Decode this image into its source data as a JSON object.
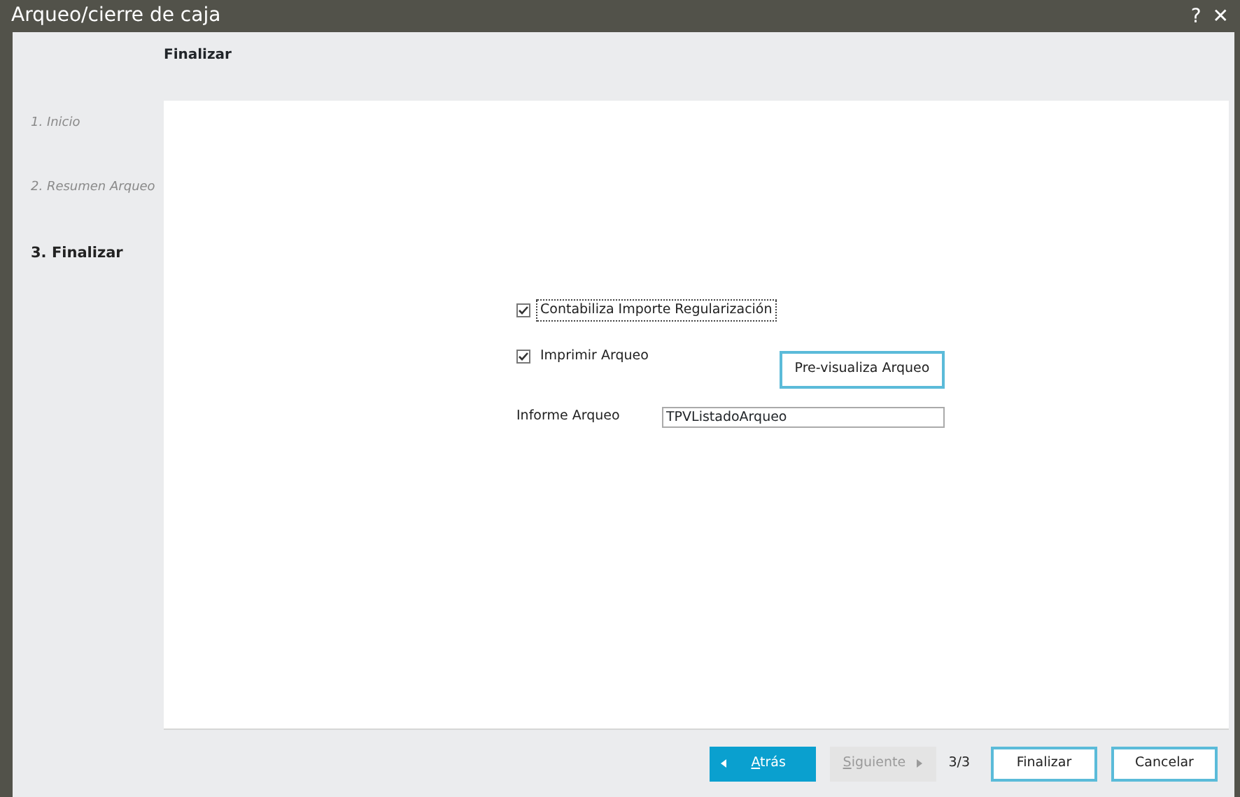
{
  "window": {
    "title": "Arqueo/cierre de caja",
    "help": "?",
    "close": "✕"
  },
  "header": {
    "title": "Finalizar"
  },
  "steps": [
    {
      "label": "1. Inicio",
      "selected": false
    },
    {
      "label": "2. Resumen Arqueo",
      "selected": false
    },
    {
      "label": "3. Finalizar",
      "selected": true
    }
  ],
  "options": [
    {
      "label": "Contabiliza Importe Regularización",
      "checked": true,
      "focused": true
    },
    {
      "label": "Imprimir Arqueo",
      "checked": true,
      "focused": false
    }
  ],
  "preview_button": "Pre-visualiza Arqueo",
  "report": {
    "label": "Informe Arqueo",
    "value": "TPVListadoArqueo"
  },
  "footer": {
    "buttons": [
      {
        "kind": "back",
        "label": "Atrás",
        "access_key": true,
        "disabled": false
      },
      {
        "kind": "next",
        "label": "Siguiente",
        "access_key": true,
        "disabled": true
      }
    ],
    "page": "3/3",
    "actions": [
      {
        "label": "Finalizar"
      },
      {
        "label": "Cancelar"
      }
    ]
  }
}
